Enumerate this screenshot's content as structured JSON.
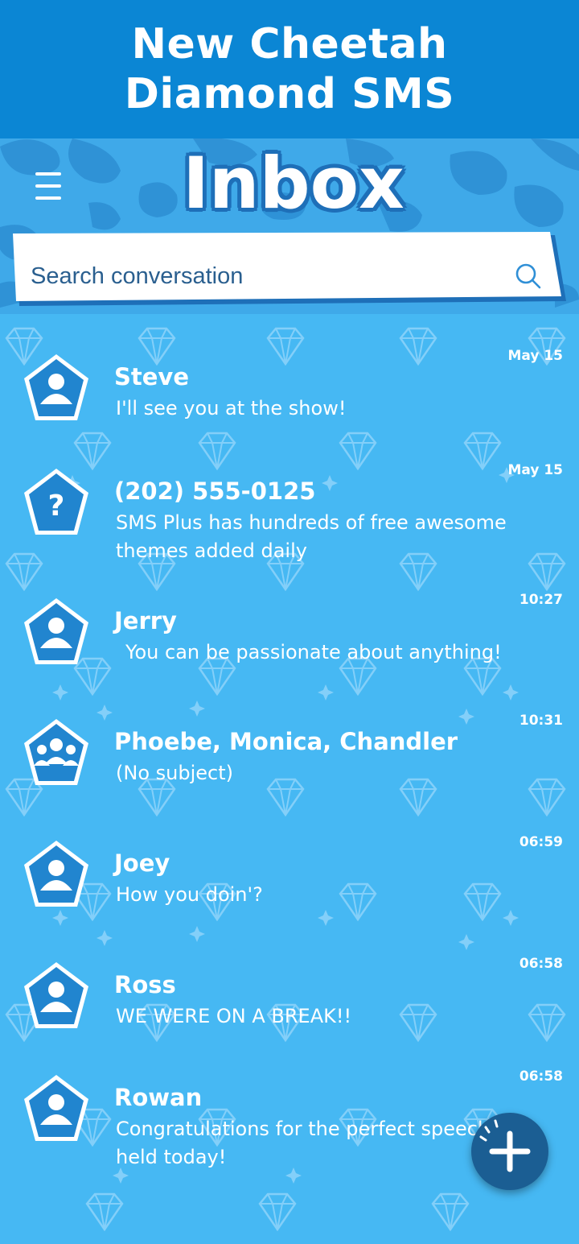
{
  "banner": {
    "line1": "New Cheetah",
    "line2": "Diamond SMS"
  },
  "header": {
    "title": "Inbox",
    "menu_icon": "hamburger-menu-icon"
  },
  "search": {
    "placeholder": "Search conversation",
    "icon": "search-icon"
  },
  "conversations": [
    {
      "name": "Steve",
      "snippet": "I'll see you at the show!",
      "time": "May 15",
      "avatar": "person-icon"
    },
    {
      "name": "(202) 555-0125",
      "snippet": "SMS Plus has hundreds of free awesome themes added daily",
      "time": "May 15",
      "avatar": "unknown-contact-icon"
    },
    {
      "name": "Jerry",
      "snippet": "You can be passionate about anything!",
      "time": "10:27",
      "avatar": "person-icon"
    },
    {
      "name": "Phoebe, Monica, Chandler",
      "snippet": "(No subject)",
      "time": "10:31",
      "avatar": "group-icon"
    },
    {
      "name": "Joey",
      "snippet": "How you doin'?",
      "time": "06:59",
      "avatar": "person-icon"
    },
    {
      "name": "Ross",
      "snippet": "WE WERE ON A BREAK!!",
      "time": "06:58",
      "avatar": "person-icon"
    },
    {
      "name": "Rowan",
      "snippet": "Congratulations for the perfect speech you held today!",
      "time": "06:58",
      "avatar": "person-icon"
    }
  ],
  "fab": {
    "icon": "plus-icon"
  },
  "colors": {
    "banner": "#0b86d4",
    "background": "#46b8f3",
    "avatar": "#2185cf",
    "fab": "#1b5e93",
    "text": "#ffffff"
  }
}
